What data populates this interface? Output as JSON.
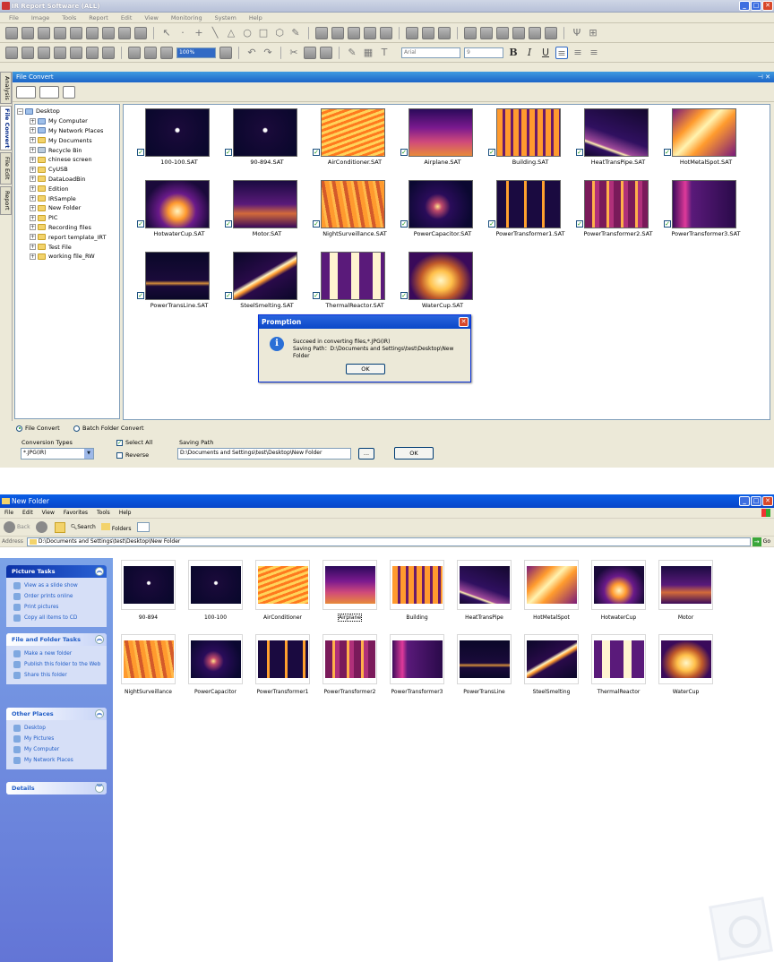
{
  "app": {
    "title": "IR Report Software (ALL)",
    "menu": [
      "File",
      "Image",
      "Tools",
      "Report",
      "Edit",
      "View",
      "Monitoring",
      "System",
      "Help"
    ],
    "zoom": "100%",
    "font_name": "Arial",
    "font_size": "9",
    "side_tabs": [
      "Analysis",
      "File Convert",
      "File Edit",
      "Report"
    ],
    "panel_title": "File Convert",
    "tree_root": "Desktop",
    "tree": [
      "My Computer",
      "My Network Places",
      "My Documents",
      "Recycle Bin",
      "chinese screen",
      "CyUSB",
      "DataLoadBin",
      "Edition",
      "IRSample",
      "New Folder",
      "PIC",
      "Recording files",
      "report template_IRT",
      "Test File",
      "working file_RW"
    ],
    "files": [
      {
        "name": "100-100.SAT",
        "style": "t-dot"
      },
      {
        "name": "90-894.SAT",
        "style": "t-dot"
      },
      {
        "name": "AirConditioner.SAT",
        "style": "t-ac"
      },
      {
        "name": "Airplane.SAT",
        "style": "t-air"
      },
      {
        "name": "Building.SAT",
        "style": "t-bld"
      },
      {
        "name": "HeatTransPipe.SAT",
        "style": "t-pipe"
      },
      {
        "name": "HotMetalSpot.SAT",
        "style": "t-hms"
      },
      {
        "name": "HotwaterCup.SAT",
        "style": "t-cup"
      },
      {
        "name": "Motor.SAT",
        "style": "t-motor"
      },
      {
        "name": "NightSurveillance.SAT",
        "style": "t-night"
      },
      {
        "name": "PowerCapacitor.SAT",
        "style": "t-pcap"
      },
      {
        "name": "PowerTransformer1.SAT",
        "style": "t-pt"
      },
      {
        "name": "PowerTransformer2.SAT",
        "style": "t-pt2"
      },
      {
        "name": "PowerTransformer3.SAT",
        "style": "t-pt3"
      },
      {
        "name": "PowerTransLine.SAT",
        "style": "t-ptl"
      },
      {
        "name": "SteelSmelting.SAT",
        "style": "t-steel"
      },
      {
        "name": "ThermalReactor.SAT",
        "style": "t-reactor"
      },
      {
        "name": "WaterCup.SAT",
        "style": "t-wcup"
      }
    ],
    "dialog": {
      "title": "Promption",
      "line1": "Succeed in converting files,*.JPG(IR)",
      "line2": "Saving Path：D:\\Documents and Settings\\test\\Desktop\\New Folder",
      "ok": "OK"
    },
    "bottom": {
      "radio_file": "File Convert",
      "radio_batch": "Batch Folder Convert",
      "conversion_label": "Conversion Types",
      "conversion_value": "*.JPG(IR)",
      "select_all": "Select All",
      "reverse": "Reverse",
      "saving_label": "Saving Path",
      "saving_value": "D:\\Documents and Settings\\test\\Desktop\\New Folder",
      "browse": "...",
      "ok": "OK"
    }
  },
  "explorer": {
    "title": "New Folder",
    "menu": [
      "File",
      "Edit",
      "View",
      "Favorites",
      "Tools",
      "Help"
    ],
    "back": "Back",
    "search": "Search",
    "folders": "Folders",
    "address_label": "Address",
    "address": "D:\\Documents and Settings\\test\\Desktop\\New Folder",
    "go": "Go",
    "picture_tasks": {
      "title": "Picture Tasks",
      "items": [
        "View as a slide show",
        "Order prints online",
        "Print pictures",
        "Copy all items to CD"
      ]
    },
    "file_tasks": {
      "title": "File and Folder Tasks",
      "items": [
        "Make a new folder",
        "Publish this folder to the Web",
        "Share this folder"
      ]
    },
    "other_places": {
      "title": "Other Places",
      "items": [
        "Desktop",
        "My Pictures",
        "My Computer",
        "My Network Places"
      ]
    },
    "details": {
      "title": "Details"
    },
    "files": [
      {
        "name": "90-894",
        "style": "t-dot"
      },
      {
        "name": "100-100",
        "style": "t-dot"
      },
      {
        "name": "AirConditioner",
        "style": "t-ac"
      },
      {
        "name": "Airplane",
        "style": "t-air"
      },
      {
        "name": "Building",
        "style": "t-bld"
      },
      {
        "name": "HeatTransPipe",
        "style": "t-pipe"
      },
      {
        "name": "HotMetalSpot",
        "style": "t-hms"
      },
      {
        "name": "HotwaterCup",
        "style": "t-cup"
      },
      {
        "name": "Motor",
        "style": "t-motor"
      },
      {
        "name": "NightSurveillance",
        "style": "t-night"
      },
      {
        "name": "PowerCapacitor",
        "style": "t-pcap"
      },
      {
        "name": "PowerTransformer1",
        "style": "t-pt"
      },
      {
        "name": "PowerTransformer2",
        "style": "t-pt2"
      },
      {
        "name": "PowerTransformer3",
        "style": "t-pt3"
      },
      {
        "name": "PowerTransLine",
        "style": "t-ptl"
      },
      {
        "name": "SteelSmelting",
        "style": "t-steel"
      },
      {
        "name": "ThermalReactor",
        "style": "t-reactor"
      },
      {
        "name": "WaterCup",
        "style": "t-wcup"
      }
    ]
  }
}
